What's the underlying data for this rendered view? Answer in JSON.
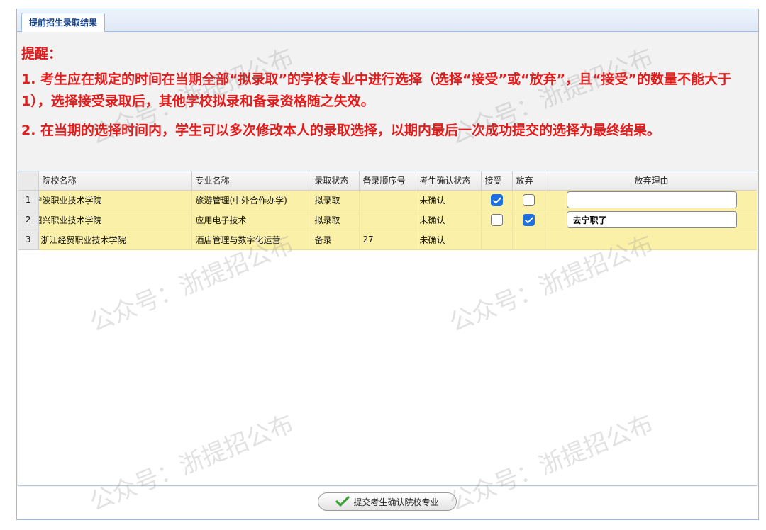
{
  "tab": {
    "label": "提前招生录取结果"
  },
  "notice": {
    "title": "提醒：",
    "line1": "1. 考生应在规定的时间在当期全部“拟录取”的学校专业中进行选择（选择“接受”或“放弃”，且“接受”的数量不能大于1），选择接受录取后，其他学校拟录和备录资格随之失效。",
    "line2": "2. 在当期的选择时间内，学生可以多次修改本人的录取选择，以期内最后一次成功提交的选择为最终结果。"
  },
  "grid": {
    "columns": {
      "school": "院校名称",
      "major": "专业名称",
      "status": "录取状态",
      "order": "备录顺序号",
      "confirm": "考生确认状态",
      "accept": "接受",
      "reject": "放弃",
      "reason": "放弃理由"
    },
    "rows": [
      {
        "num": "1",
        "school": "宁波职业技术学院",
        "major": "旅游管理(中外合作办学)",
        "status": "拟录取",
        "order": "",
        "confirm": "未确认",
        "accept": true,
        "reject": false,
        "reason": ""
      },
      {
        "num": "2",
        "school": "绍兴职业技术学院",
        "major": "应用电子技术",
        "status": "拟录取",
        "order": "",
        "confirm": "未确认",
        "accept": false,
        "reject": true,
        "reason": "去宁职了"
      },
      {
        "num": "3",
        "school": "浙江经贸职业技术学院",
        "major": "酒店管理与数字化运营",
        "status": "备录",
        "order": "27",
        "confirm": "未确认"
      }
    ]
  },
  "footer": {
    "submit_label": "提交考生确认院校专业"
  },
  "watermark": {
    "text": "公众号：浙提招公布"
  },
  "colors": {
    "notice_red": "#e31b1b",
    "row_yellow": "#faf0a8",
    "checkbox_blue": "#1e6fe0"
  }
}
